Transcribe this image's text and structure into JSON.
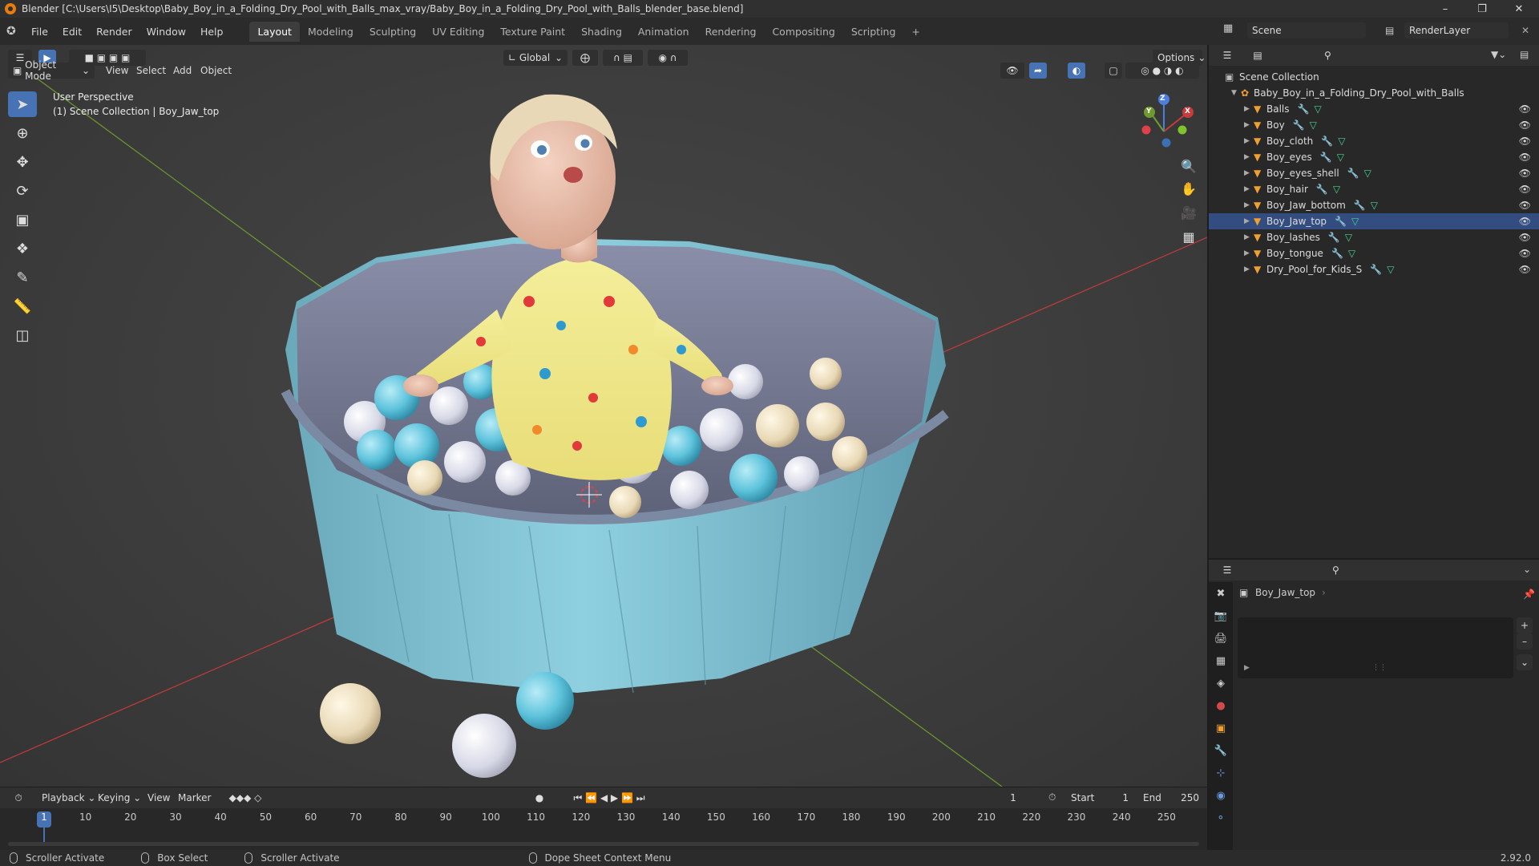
{
  "window": {
    "title": "Blender [C:\\Users\\I5\\Desktop\\Baby_Boy_in_a_Folding_Dry_Pool_with_Balls_max_vray/Baby_Boy_in_a_Folding_Dry_Pool_with_Balls_blender_base.blend]"
  },
  "menu": [
    "File",
    "Edit",
    "Render",
    "Window",
    "Help"
  ],
  "workspaces": [
    {
      "label": "Layout",
      "active": true
    },
    {
      "label": "Modeling"
    },
    {
      "label": "Sculpting"
    },
    {
      "label": "UV Editing"
    },
    {
      "label": "Texture Paint"
    },
    {
      "label": "Shading"
    },
    {
      "label": "Animation"
    },
    {
      "label": "Rendering"
    },
    {
      "label": "Compositing"
    },
    {
      "label": "Scripting"
    }
  ],
  "topright": {
    "scene": "Scene",
    "render_layer": "RenderLayer"
  },
  "viewport": {
    "mode": "Object Mode",
    "menus": [
      "View",
      "Select",
      "Add",
      "Object"
    ],
    "transform_orientation": "Global",
    "options_label": "Options",
    "info_line1": "User Perspective",
    "info_line2": "(1) Scene Collection | Boy_Jaw_top",
    "axis_x": "X",
    "axis_y": "Y",
    "axis_z": "Z"
  },
  "outliner": {
    "scene_collection": "Scene Collection",
    "root_object": "Baby_Boy_in_a_Folding_Dry_Pool_with_Balls",
    "selected": "Boy_Jaw_top",
    "items": [
      "Balls",
      "Boy",
      "Boy_cloth",
      "Boy_eyes",
      "Boy_eyes_shell",
      "Boy_hair",
      "Boy_Jaw_bottom",
      "Boy_Jaw_top",
      "Boy_lashes",
      "Boy_tongue",
      "Dry_Pool_for_Kids_S"
    ]
  },
  "properties": {
    "object_name": "Boy_Jaw_top"
  },
  "timeline": {
    "menus": [
      "Playback",
      "Keying",
      "View",
      "Marker"
    ],
    "current_frame": "1",
    "start_label": "Start",
    "start": "1",
    "end_label": "End",
    "end": "250",
    "ticks": [
      "1",
      "10",
      "20",
      "30",
      "40",
      "50",
      "60",
      "70",
      "80",
      "90",
      "100",
      "110",
      "120",
      "130",
      "140",
      "150",
      "160",
      "170",
      "180",
      "190",
      "200",
      "210",
      "220",
      "230",
      "240",
      "250"
    ]
  },
  "statusbar": {
    "items": [
      "Scroller Activate",
      "Box Select",
      "Scroller Activate",
      "Dope Sheet Context Menu"
    ],
    "version": "2.92.0"
  },
  "colors": {
    "accent": "#4772b3",
    "selected_row": "#334d80",
    "playhead": "#4772b3",
    "axis_red": "#c83b3b",
    "axis_green": "#6e9a2e"
  }
}
